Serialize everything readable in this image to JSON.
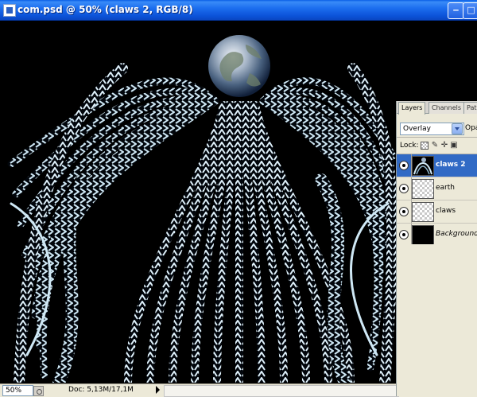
{
  "window": {
    "title": "com.psd @ 50% (claws 2, RGB/8)",
    "icon": "photoshop-document-icon",
    "minimize_icon": "minimize-icon",
    "maximize_icon": "maximize-icon"
  },
  "status": {
    "zoom": "50%",
    "doc_info": "Doc: 5,13M/17,1M"
  },
  "layers_panel": {
    "tabs": [
      {
        "label": "Layers",
        "active": true
      },
      {
        "label": "Channels",
        "active": false
      },
      {
        "label": "Path",
        "active": false
      }
    ],
    "blend_mode": "Overlay",
    "opacity_label": "Opa",
    "lock_label": "Lock:",
    "layers": [
      {
        "name": "claws 2",
        "selected": true,
        "visible": true,
        "thumbnail": "claws-art"
      },
      {
        "name": "earth",
        "selected": false,
        "visible": true,
        "thumbnail": "transparent"
      },
      {
        "name": "claws",
        "selected": false,
        "visible": true,
        "thumbnail": "transparent"
      },
      {
        "name": "Background",
        "selected": false,
        "visible": true,
        "thumbnail": "black"
      }
    ]
  },
  "colors": {
    "titlebar": "#0b52d8",
    "selected_layer": "#316ac5",
    "panel_bg": "#ece9d8",
    "canvas_bg": "#000000",
    "art_highlight": "#cfe8f5"
  }
}
